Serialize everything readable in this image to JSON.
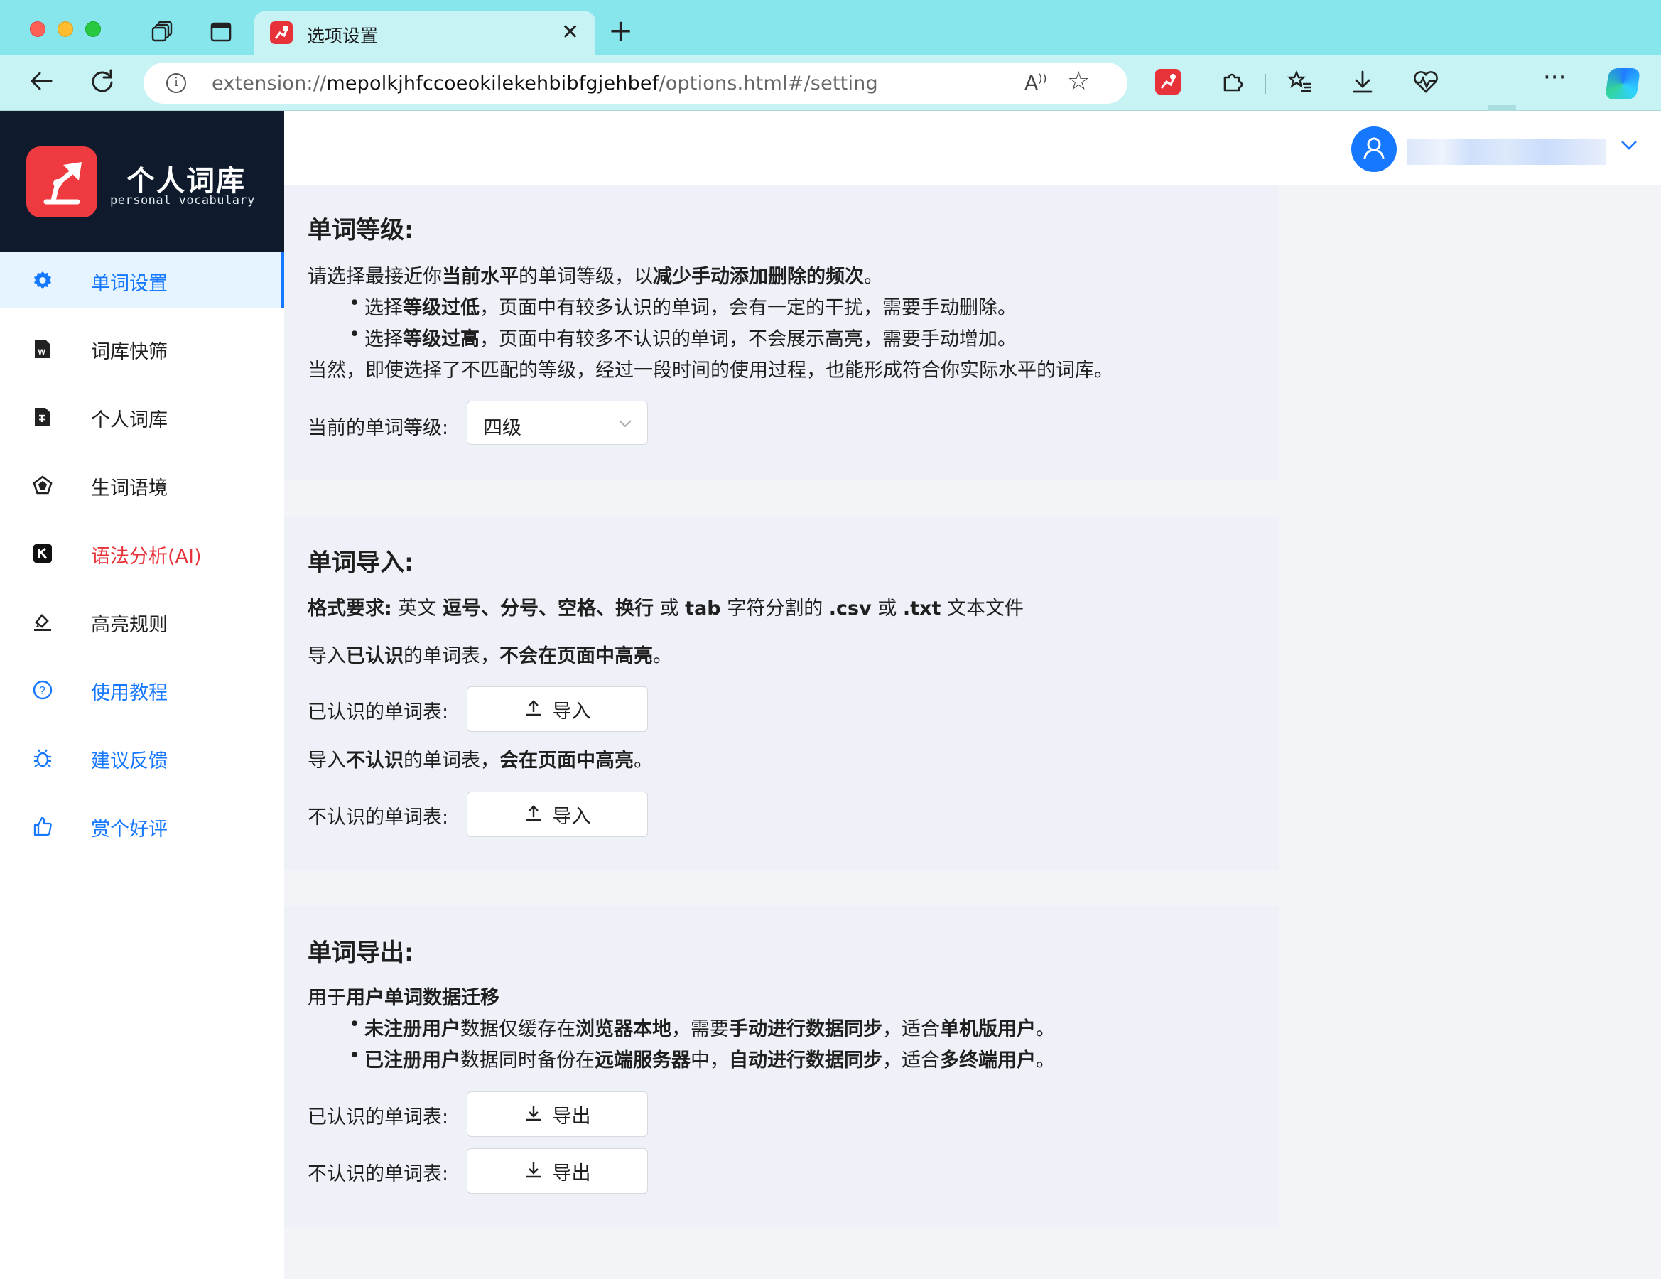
{
  "browser": {
    "tab_title": "选项设置",
    "url_prefix": "extension://",
    "url_host": "mepolkjhfccoeokilekehbibfgjehbef",
    "url_path": "/options.html#/setting"
  },
  "brand": {
    "title": "个人词库",
    "subtitle": "personal vocabulary"
  },
  "sidebar": {
    "items": [
      {
        "label": "单词设置",
        "icon": "gear-icon"
      },
      {
        "label": "词库快筛",
        "icon": "word-document-icon"
      },
      {
        "label": "个人词库",
        "icon": "vocabulary-file-icon"
      },
      {
        "label": "生词语境",
        "icon": "pentagon-context-icon"
      },
      {
        "label": "语法分析(AI)",
        "icon": "ai-grammar-icon"
      },
      {
        "label": "高亮规则",
        "icon": "highlighter-icon"
      },
      {
        "label": "使用教程",
        "icon": "question-circle-icon"
      },
      {
        "label": "建议反馈",
        "icon": "bug-icon"
      },
      {
        "label": "赏个好评",
        "icon": "thumbs-up-icon"
      }
    ]
  },
  "level": {
    "title": "单词等级:",
    "intro_a": "请选择最接近你",
    "intro_b": "当前水平",
    "intro_c": "的单词等级，以",
    "intro_d": "减少手动添加删除的频次",
    "intro_e": "。",
    "b1_a": "选择",
    "b1_b": "等级过低",
    "b1_c": "，页面中有较多认识的单词，会有一定的干扰，需要手动删除。",
    "b2_a": "选择",
    "b2_b": "等级过高",
    "b2_c": "，页面中有较多不认识的单词，不会展示高亮，需要手动增加。",
    "note": "当然，即使选择了不匹配的等级，经过一段时间的使用过程，也能形成符合你实际水平的词库。",
    "select_label": "当前的单词等级:",
    "select_value": "四级"
  },
  "import": {
    "title": "单词导入:",
    "fmt_a": "格式要求:",
    "fmt_b": " 英文 ",
    "fmt_c": "逗号、分号、空格、换行",
    "fmt_d": " 或 ",
    "fmt_e": "tab",
    "fmt_f": " 字符分割的 ",
    "fmt_g": ".csv",
    "fmt_h": " 或 ",
    "fmt_i": ".txt",
    "fmt_j": " 文本文件",
    "known_a": "导入",
    "known_b": "已认识",
    "known_c": "的单词表，",
    "known_d": "不会在页面中高亮",
    "known_e": "。",
    "known_label": "已认识的单词表:",
    "unknown_a": "导入",
    "unknown_b": "不认识",
    "unknown_c": "的单词表，",
    "unknown_d": "会在页面中高亮",
    "unknown_e": "。",
    "unknown_label": "不认识的单词表:",
    "button_label": "导入"
  },
  "export": {
    "title": "单词导出:",
    "intro_a": "用于",
    "intro_b": "用户单词数据迁移",
    "b1_a": "未注册用户",
    "b1_b": "数据仅缓存在",
    "b1_c": "浏览器本地",
    "b1_d": "，需要",
    "b1_e": "手动进行数据同步",
    "b1_f": "，适合",
    "b1_g": "单机版用户",
    "b1_h": "。",
    "b2_a": "已注册用户",
    "b2_b": "数据同时备份在",
    "b2_c": "远端服务器",
    "b2_d": "中，",
    "b2_e": "自动进行数据同步",
    "b2_f": "，适合",
    "b2_g": "多终端用户",
    "b2_h": "。",
    "known_label": "已认识的单词表:",
    "unknown_label": "不认识的单词表:",
    "button_label": "导出"
  },
  "colors": {
    "accent": "#1677ff",
    "brand_red": "#e8323a",
    "sidebar_dark": "#0f1b2d"
  }
}
